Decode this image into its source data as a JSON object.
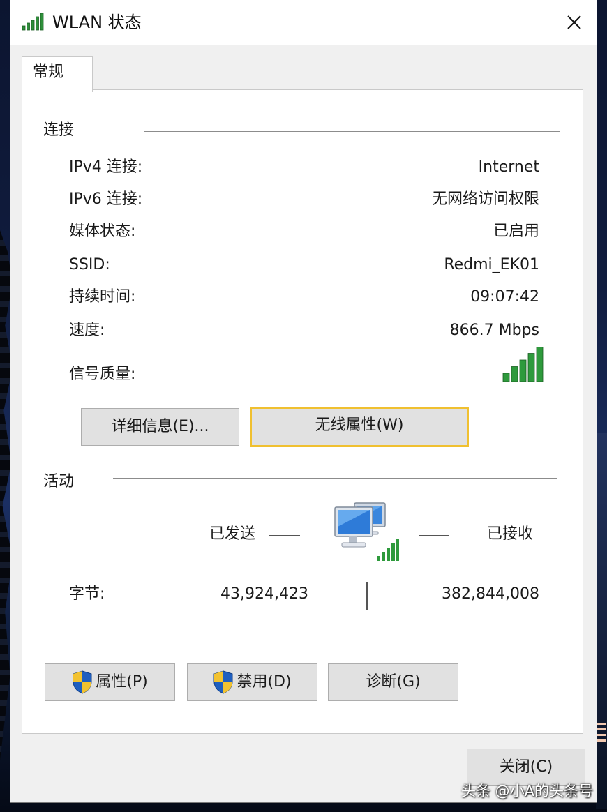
{
  "window": {
    "title": "WLAN 状态",
    "title_icon": "wifi-signal-icon",
    "close_icon": "close-icon"
  },
  "tabs": [
    {
      "label": "常规",
      "selected": true
    }
  ],
  "connection": {
    "group_label": "连接",
    "rows": [
      {
        "label": "IPv4 连接:",
        "value": "Internet"
      },
      {
        "label": "IPv6 连接:",
        "value": "无网络访问权限"
      },
      {
        "label": "媒体状态:",
        "value": "已启用"
      },
      {
        "label": "SSID:",
        "value": "Redmi_EK01"
      },
      {
        "label": "持续时间:",
        "value": "09:07:42"
      },
      {
        "label": "速度:",
        "value": "866.7 Mbps"
      }
    ],
    "signal_label": "信号质量:",
    "signal_bars": 5,
    "signal_max_bars": 5,
    "buttons": {
      "details": "详细信息(E)...",
      "wireless_properties": "无线属性(W)"
    }
  },
  "activity": {
    "group_label": "活动",
    "sent_label": "已发送",
    "received_label": "已接收",
    "bytes_label": "字节:",
    "bytes_sent": "43,924,423",
    "bytes_received": "382,844,008",
    "network_icon": "network-computers-icon"
  },
  "bottom_buttons": {
    "properties": "属性(P)",
    "disable": "禁用(D)",
    "diagnose": "诊断(G)"
  },
  "dialog": {
    "close_button": "关闭(C)"
  },
  "watermark": "头条 @小A的头条号",
  "colors": {
    "window_bg": "#f0f0f0",
    "panel_bg": "#ffffff",
    "button_bg": "#e1e1e1",
    "focus_border": "#f0c030",
    "signal_green": "#2e9a3c",
    "shield_blue": "#1f5fbf",
    "shield_yellow": "#f2c230"
  }
}
